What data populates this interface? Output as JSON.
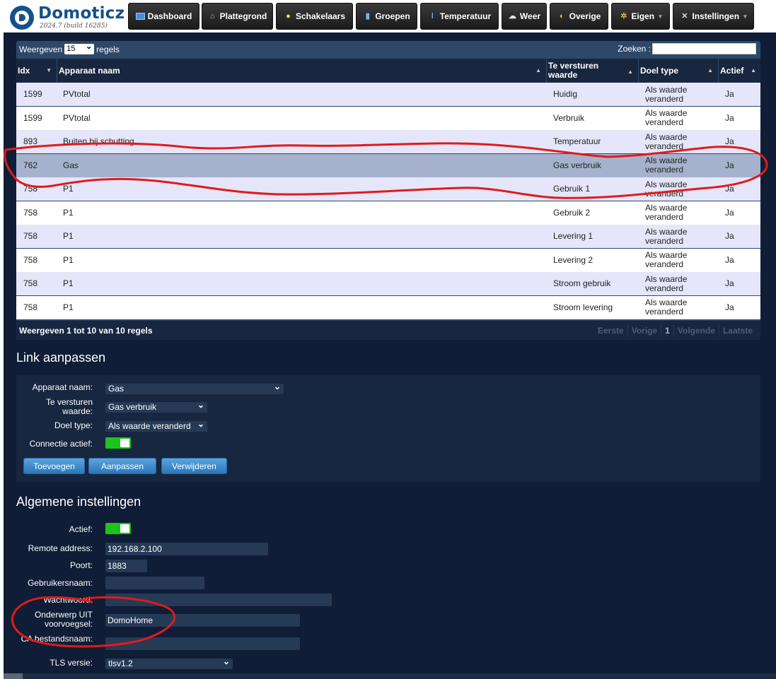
{
  "app": {
    "name": "Domoticz",
    "build": "2024.7 (build 16285)"
  },
  "nav": [
    {
      "label": "Dashboard",
      "icon": "monitor-icon"
    },
    {
      "label": "Plattegrond",
      "icon": "house-icon"
    },
    {
      "label": "Schakelaars",
      "icon": "lightbulb-icon"
    },
    {
      "label": "Groepen",
      "icon": "group-icon"
    },
    {
      "label": "Temperatuur",
      "icon": "thermometer-icon"
    },
    {
      "label": "Weer",
      "icon": "cloud-icon"
    },
    {
      "label": "Overige",
      "icon": "misc-icon"
    },
    {
      "label": "Eigen",
      "icon": "gear-icon",
      "dropdown": true
    },
    {
      "label": "Instellingen",
      "icon": "tools-icon",
      "dropdown": true
    }
  ],
  "table": {
    "show_prefix": "Weergeven",
    "show_value": "15",
    "show_suffix": "regels",
    "search_label": "Zoeken :",
    "search_value": "",
    "columns": [
      "Idx",
      "Apparaat naam",
      "Te versturen waarde",
      "Doel type",
      "Actief"
    ],
    "rows": [
      {
        "idx": "1599",
        "name": "PVtotal",
        "value": "Huidig",
        "type": "Als waarde veranderd",
        "active": "Ja"
      },
      {
        "idx": "1599",
        "name": "PVtotal",
        "value": "Verbruik",
        "type": "Als waarde veranderd",
        "active": "Ja"
      },
      {
        "idx": "893",
        "name": "Buiten bij schutting",
        "value": "Temperatuur",
        "type": "Als waarde veranderd",
        "active": "Ja"
      },
      {
        "idx": "762",
        "name": "Gas",
        "value": "Gas verbruik",
        "type": "Als waarde veranderd",
        "active": "Ja",
        "selected": true
      },
      {
        "idx": "758",
        "name": "P1",
        "value": "Gebruik 1",
        "type": "Als waarde veranderd",
        "active": "Ja"
      },
      {
        "idx": "758",
        "name": "P1",
        "value": "Gebruik 2",
        "type": "Als waarde veranderd",
        "active": "Ja"
      },
      {
        "idx": "758",
        "name": "P1",
        "value": "Levering 1",
        "type": "Als waarde veranderd",
        "active": "Ja"
      },
      {
        "idx": "758",
        "name": "P1",
        "value": "Levering 2",
        "type": "Als waarde veranderd",
        "active": "Ja"
      },
      {
        "idx": "758",
        "name": "P1",
        "value": "Stroom gebruik",
        "type": "Als waarde veranderd",
        "active": "Ja"
      },
      {
        "idx": "758",
        "name": "P1",
        "value": "Stroom levering",
        "type": "Als waarde veranderd",
        "active": "Ja"
      }
    ],
    "info": "Weergeven 1 tot 10 van 10 regels",
    "pager": {
      "first": "Eerste",
      "prev": "Vorige",
      "page": "1",
      "next": "Volgende",
      "last": "Laatste"
    }
  },
  "link_form": {
    "title": "Link aanpassen",
    "device_label": "Apparaat naam:",
    "device_value": "Gas",
    "value_label": "Te versturen waarde:",
    "value_value": "Gas verbruik",
    "target_label": "Doel type:",
    "target_value": "Als waarde veranderd",
    "active_label": "Connectie actief:",
    "active": true,
    "add_button": "Toevoegen",
    "update_button": "Aanpassen",
    "delete_button": "Verwijderen"
  },
  "general": {
    "title": "Algemene instellingen",
    "active_label": "Actief:",
    "active": true,
    "remote_label": "Remote address:",
    "remote_value": "192.168.2.100",
    "port_label": "Poort:",
    "port_value": "1883",
    "user_label": "Gebruikersnaam:",
    "user_value": "",
    "password_label": "Wachtwoord:",
    "password_value": "",
    "topic_label": "Onderwerp UIT voorvoegsel:",
    "topic_value": "DomoHome",
    "ca_label": "CA bestandsnaam:",
    "ca_value": "",
    "tls_label": "TLS versie:",
    "tls_value": "tlsv1.2"
  },
  "colors": {
    "content_bg": "#0f1d36",
    "header_row": "#18273f",
    "odd_row": "#e5e6f9",
    "selected_row": "#a6b2cd",
    "toggle_on": "#1cc31c",
    "button": "#2a77b9",
    "annotation": "#e01b1b"
  }
}
